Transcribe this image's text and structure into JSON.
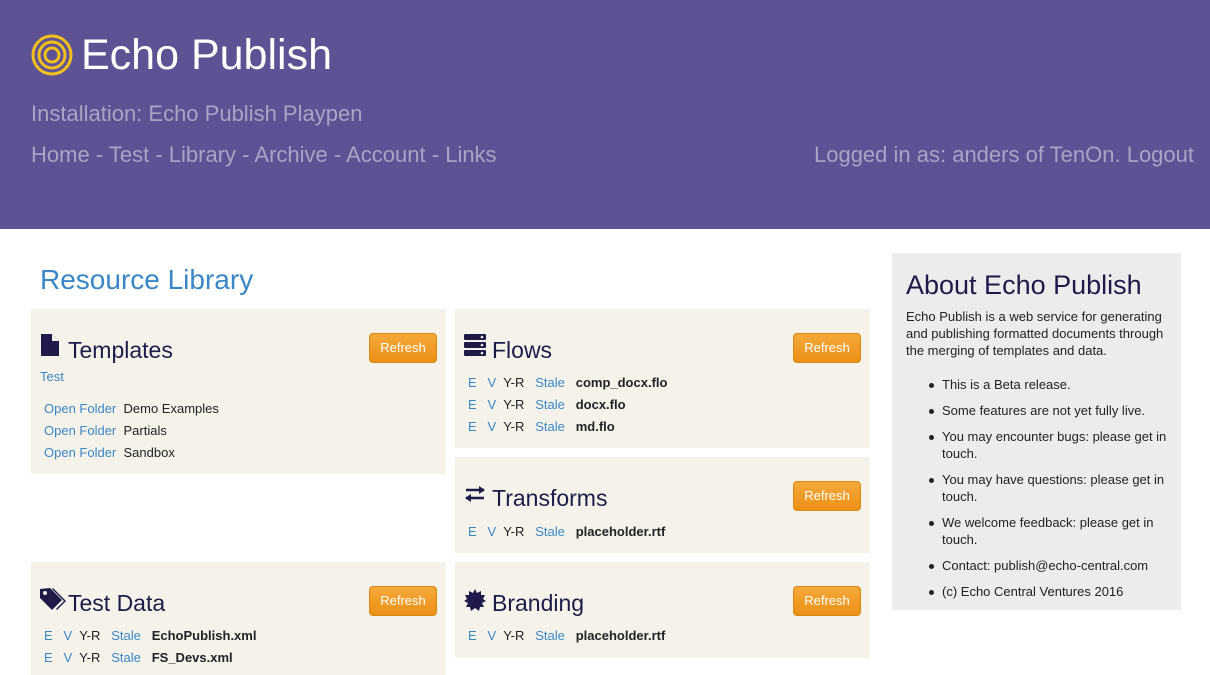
{
  "header": {
    "app_title": "Echo Publish",
    "installation": "Installation: Echo Publish Playpen",
    "nav": [
      "Home",
      "Test",
      "Library",
      "Archive",
      "Account",
      "Links"
    ],
    "nav_separator": "-",
    "login_text": "Logged in as: anders of TenOn.",
    "logout_label": "Logout",
    "logo_color": "#f2c01e",
    "bg_color": "#5d5293"
  },
  "library": {
    "title": "Resource Library",
    "refresh_label": "Refresh",
    "templates": {
      "title": "Templates",
      "icon": "file-icon",
      "test_link": "Test",
      "folders": [
        {
          "action": "Open Folder",
          "name": "Demo Examples"
        },
        {
          "action": "Open Folder",
          "name": "Partials"
        },
        {
          "action": "Open Folder",
          "name": "Sandbox"
        }
      ]
    },
    "flows": {
      "title": "Flows",
      "icon": "server-icon",
      "files": [
        {
          "e": "E",
          "v": "V",
          "yr": "Y-R",
          "stale": "Stale",
          "name": "comp_docx.flo"
        },
        {
          "e": "E",
          "v": "V",
          "yr": "Y-R",
          "stale": "Stale",
          "name": "docx.flo"
        },
        {
          "e": "E",
          "v": "V",
          "yr": "Y-R",
          "stale": "Stale",
          "name": "md.flo"
        }
      ]
    },
    "transforms": {
      "title": "Transforms",
      "icon": "transfer-icon",
      "files": [
        {
          "e": "E",
          "v": "V",
          "yr": "Y-R",
          "stale": "Stale",
          "name": "placeholder.rtf"
        }
      ]
    },
    "test_data": {
      "title": "Test Data",
      "icon": "tags-icon",
      "files": [
        {
          "e": "E",
          "v": "V",
          "yr": "Y-R",
          "stale": "Stale",
          "name": "EchoPublish.xml"
        },
        {
          "e": "E",
          "v": "V",
          "yr": "Y-R",
          "stale": "Stale",
          "name": "FS_Devs.xml"
        }
      ]
    },
    "branding": {
      "title": "Branding",
      "icon": "certificate-icon",
      "files": [
        {
          "e": "E",
          "v": "V",
          "yr": "Y-R",
          "stale": "Stale",
          "name": "placeholder.rtf"
        }
      ]
    }
  },
  "about": {
    "title": "About Echo Publish",
    "description": "Echo Publish is a web service for generating and publishing formatted documents through the merging of templates and data.",
    "items": [
      "This is a Beta release.",
      "Some features are not yet fully live.",
      "You may encounter bugs: please get in touch.",
      "You may have questions: please get in touch.",
      "We welcome feedback: please get in touch.",
      "Contact: publish@echo-central.com",
      "(c) Echo Central Ventures 2016"
    ]
  }
}
